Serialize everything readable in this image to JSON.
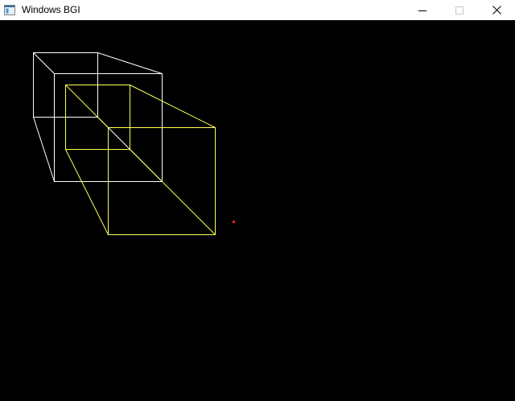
{
  "window": {
    "title": "Windows BGI",
    "icon": "app-window-icon",
    "controls": {
      "minimize_icon": "minimize-icon",
      "maximize_icon": "maximize-icon",
      "close_icon": "close-icon"
    }
  },
  "canvas": {
    "background": "#000000",
    "colors": {
      "white_cube": "#ffffff",
      "yellow_cube": "#ffff55",
      "point": "#ff2020"
    }
  }
}
